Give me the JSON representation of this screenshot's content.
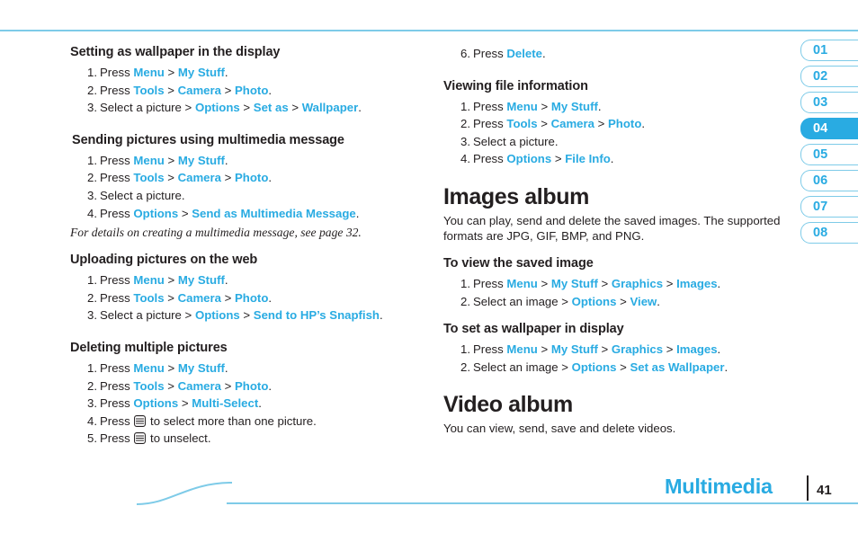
{
  "page": {
    "footer_title": "Multimedia",
    "page_number": "41"
  },
  "tabs": [
    {
      "label": "01",
      "active": false
    },
    {
      "label": "02",
      "active": false
    },
    {
      "label": "03",
      "active": false
    },
    {
      "label": "04",
      "active": true
    },
    {
      "label": "05",
      "active": false
    },
    {
      "label": "06",
      "active": false
    },
    {
      "label": "07",
      "active": false
    },
    {
      "label": "08",
      "active": false
    }
  ],
  "left_column": {
    "s1": {
      "heading": "Setting as wallpaper in the display",
      "steps": [
        {
          "parts": [
            {
              "t": "Press ",
              "s": "n"
            },
            {
              "t": "Menu",
              "s": "k"
            },
            {
              "t": " > ",
              "s": "n"
            },
            {
              "t": "My Stuff",
              "s": "k"
            },
            {
              "t": ".",
              "s": "n"
            }
          ]
        },
        {
          "parts": [
            {
              "t": "Press ",
              "s": "n"
            },
            {
              "t": "Tools",
              "s": "k"
            },
            {
              "t": " > ",
              "s": "n"
            },
            {
              "t": "Camera",
              "s": "k"
            },
            {
              "t": " > ",
              "s": "n"
            },
            {
              "t": "Photo",
              "s": "k"
            },
            {
              "t": ".",
              "s": "n"
            }
          ]
        },
        {
          "parts": [
            {
              "t": "Select a picture > ",
              "s": "n"
            },
            {
              "t": "Options",
              "s": "k"
            },
            {
              "t": " > ",
              "s": "n"
            },
            {
              "t": "Set as",
              "s": "k"
            },
            {
              "t": " > ",
              "s": "n"
            },
            {
              "t": "Wallpaper",
              "s": "k"
            },
            {
              "t": ".",
              "s": "n"
            }
          ]
        }
      ]
    },
    "s2": {
      "heading": "Sending pictures using multimedia message",
      "steps": [
        {
          "parts": [
            {
              "t": "Press ",
              "s": "n"
            },
            {
              "t": "Menu",
              "s": "k"
            },
            {
              "t": " > ",
              "s": "n"
            },
            {
              "t": "My Stuff",
              "s": "k"
            },
            {
              "t": ".",
              "s": "n"
            }
          ]
        },
        {
          "parts": [
            {
              "t": "Press ",
              "s": "n"
            },
            {
              "t": "Tools",
              "s": "k"
            },
            {
              "t": " > ",
              "s": "n"
            },
            {
              "t": "Camera",
              "s": "k"
            },
            {
              "t": " > ",
              "s": "n"
            },
            {
              "t": "Photo",
              "s": "k"
            },
            {
              "t": ".",
              "s": "n"
            }
          ]
        },
        {
          "parts": [
            {
              "t": "Select a picture.",
              "s": "n"
            }
          ]
        },
        {
          "parts": [
            {
              "t": "Press ",
              "s": "n"
            },
            {
              "t": "Options",
              "s": "k"
            },
            {
              "t": " > ",
              "s": "n"
            },
            {
              "t": "Send as Multimedia Message",
              "s": "k"
            },
            {
              "t": ".",
              "s": "n"
            }
          ]
        }
      ],
      "note": "For details on creating a multimedia message, see page 32."
    },
    "s3": {
      "heading": "Uploading pictures on the web",
      "steps": [
        {
          "parts": [
            {
              "t": "Press ",
              "s": "n"
            },
            {
              "t": "Menu",
              "s": "k"
            },
            {
              "t": " > ",
              "s": "n"
            },
            {
              "t": "My Stuff",
              "s": "k"
            },
            {
              "t": ".",
              "s": "n"
            }
          ]
        },
        {
          "parts": [
            {
              "t": "Press ",
              "s": "n"
            },
            {
              "t": "Tools",
              "s": "k"
            },
            {
              "t": " > ",
              "s": "n"
            },
            {
              "t": "Camera",
              "s": "k"
            },
            {
              "t": " > ",
              "s": "n"
            },
            {
              "t": "Photo",
              "s": "k"
            },
            {
              "t": ".",
              "s": "n"
            }
          ]
        },
        {
          "parts": [
            {
              "t": "Select a picture > ",
              "s": "n"
            },
            {
              "t": "Options",
              "s": "k"
            },
            {
              "t": " > ",
              "s": "n"
            },
            {
              "t": "Send to HP’s Snapfish",
              "s": "k"
            },
            {
              "t": ".",
              "s": "n"
            }
          ]
        }
      ]
    },
    "s4": {
      "heading": "Deleting multiple pictures",
      "steps": [
        {
          "parts": [
            {
              "t": "Press ",
              "s": "n"
            },
            {
              "t": "Menu",
              "s": "k"
            },
            {
              "t": " > ",
              "s": "n"
            },
            {
              "t": "My Stuff",
              "s": "k"
            },
            {
              "t": ".",
              "s": "n"
            }
          ]
        },
        {
          "parts": [
            {
              "t": "Press ",
              "s": "n"
            },
            {
              "t": "Tools",
              "s": "k"
            },
            {
              "t": " > ",
              "s": "n"
            },
            {
              "t": "Camera",
              "s": "k"
            },
            {
              "t": " > ",
              "s": "n"
            },
            {
              "t": "Photo",
              "s": "k"
            },
            {
              "t": ".",
              "s": "n"
            }
          ]
        },
        {
          "parts": [
            {
              "t": "Press ",
              "s": "n"
            },
            {
              "t": "Options",
              "s": "k"
            },
            {
              "t": " > ",
              "s": "n"
            },
            {
              "t": "Multi-Select",
              "s": "k"
            },
            {
              "t": ".",
              "s": "n"
            }
          ]
        },
        {
          "parts": [
            {
              "t": "Press ",
              "s": "n"
            },
            {
              "t": "",
              "s": "icon"
            },
            {
              "t": " to select more than one picture.",
              "s": "n"
            }
          ]
        },
        {
          "parts": [
            {
              "t": "Press ",
              "s": "n"
            },
            {
              "t": "",
              "s": "icon"
            },
            {
              "t": " to unselect.",
              "s": "n"
            }
          ]
        }
      ]
    }
  },
  "right_column": {
    "s0": {
      "steps": [
        {
          "parts": [
            {
              "t": "Press ",
              "s": "n"
            },
            {
              "t": "Delete",
              "s": "k"
            },
            {
              "t": ".",
              "s": "n"
            }
          ]
        }
      ]
    },
    "s1": {
      "heading": "Viewing file information",
      "steps": [
        {
          "parts": [
            {
              "t": "Press ",
              "s": "n"
            },
            {
              "t": "Menu",
              "s": "k"
            },
            {
              "t": " > ",
              "s": "n"
            },
            {
              "t": "My Stuff",
              "s": "k"
            },
            {
              "t": ".",
              "s": "n"
            }
          ]
        },
        {
          "parts": [
            {
              "t": "Press ",
              "s": "n"
            },
            {
              "t": "Tools",
              "s": "k"
            },
            {
              "t": " > ",
              "s": "n"
            },
            {
              "t": "Camera",
              "s": "k"
            },
            {
              "t": " > ",
              "s": "n"
            },
            {
              "t": "Photo",
              "s": "k"
            },
            {
              "t": ".",
              "s": "n"
            }
          ]
        },
        {
          "parts": [
            {
              "t": "Select a picture.",
              "s": "n"
            }
          ]
        },
        {
          "parts": [
            {
              "t": "Press ",
              "s": "n"
            },
            {
              "t": "Options",
              "s": "k"
            },
            {
              "t": " > ",
              "s": "n"
            },
            {
              "t": "File Info",
              "s": "k"
            },
            {
              "t": ".",
              "s": "n"
            }
          ]
        }
      ]
    },
    "images_album": {
      "heading": "Images album",
      "body": "You can play, send and delete the saved images. The supported formats are JPG, GIF, BMP, and PNG."
    },
    "s2": {
      "heading": "To view the saved image",
      "steps": [
        {
          "parts": [
            {
              "t": "Press ",
              "s": "n"
            },
            {
              "t": "Menu",
              "s": "k"
            },
            {
              "t": " > ",
              "s": "n"
            },
            {
              "t": "My Stuff",
              "s": "k"
            },
            {
              "t": " > ",
              "s": "n"
            },
            {
              "t": "Graphics",
              "s": "k"
            },
            {
              "t": " > ",
              "s": "n"
            },
            {
              "t": "Images",
              "s": "k"
            },
            {
              "t": ".",
              "s": "n"
            }
          ]
        },
        {
          "parts": [
            {
              "t": "Select an image > ",
              "s": "n"
            },
            {
              "t": "Options",
              "s": "k"
            },
            {
              "t": " > ",
              "s": "n"
            },
            {
              "t": "View",
              "s": "k"
            },
            {
              "t": ".",
              "s": "n"
            }
          ]
        }
      ]
    },
    "s3": {
      "heading": "To set as wallpaper in display",
      "steps": [
        {
          "parts": [
            {
              "t": "Press ",
              "s": "n"
            },
            {
              "t": "Menu",
              "s": "k"
            },
            {
              "t": " > ",
              "s": "n"
            },
            {
              "t": "My Stuff",
              "s": "k"
            },
            {
              "t": " > ",
              "s": "n"
            },
            {
              "t": "Graphics",
              "s": "k"
            },
            {
              "t": " > ",
              "s": "n"
            },
            {
              "t": "Images",
              "s": "k"
            },
            {
              "t": ".",
              "s": "n"
            }
          ]
        },
        {
          "parts": [
            {
              "t": "Select an image > ",
              "s": "n"
            },
            {
              "t": "Options",
              "s": "k"
            },
            {
              "t": " > ",
              "s": "n"
            },
            {
              "t": "Set as Wallpaper",
              "s": "k"
            },
            {
              "t": ".",
              "s": "n"
            }
          ]
        }
      ]
    },
    "video_album": {
      "heading": "Video album",
      "body": "You can view, send, save and delete videos."
    }
  },
  "colors": {
    "accent": "#29abe2",
    "rule": "#7ecbe8",
    "text": "#231f20"
  }
}
